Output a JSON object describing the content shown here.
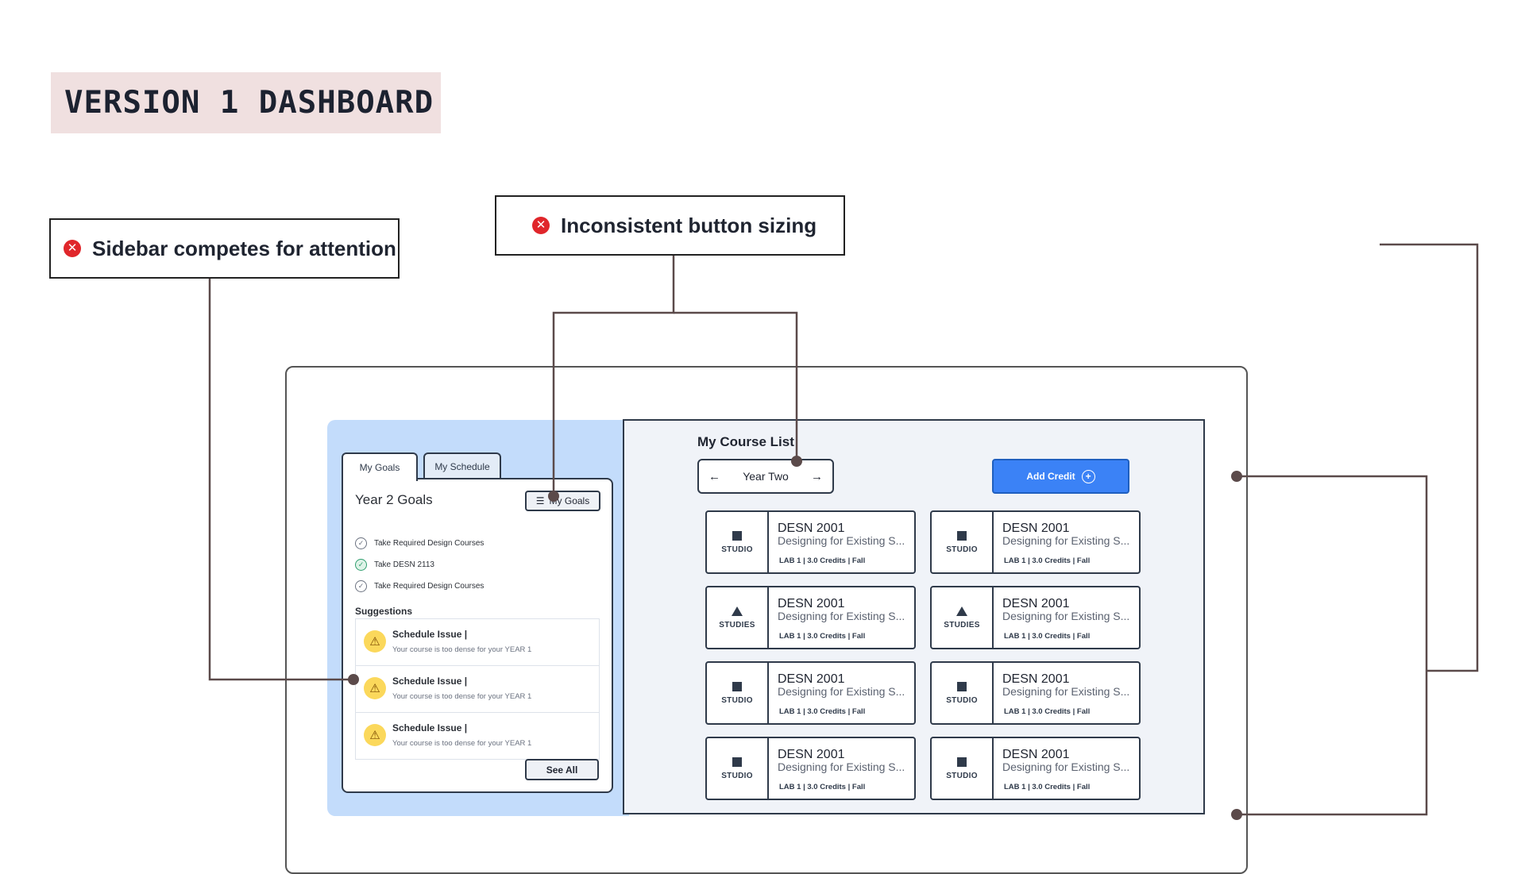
{
  "title": "VERSION 1 DASHBOARD",
  "callouts": {
    "sidebar": "Sidebar competes for attention",
    "buttons": "Inconsistent button sizing"
  },
  "sidebar": {
    "tabs": [
      "My Goals",
      "My Schedule"
    ],
    "card_title": "Year 2 Goals",
    "my_goals_button": "My Goals",
    "goals": [
      {
        "label": "Take Required Design Courses",
        "done": false
      },
      {
        "label": "Take DESN 2113",
        "done": true
      },
      {
        "label": "Take Required Design Courses",
        "done": false
      }
    ],
    "suggestions_label": "Suggestions",
    "suggestions": [
      {
        "title": "Schedule Issue |",
        "text": "Your course is too dense for your YEAR 1"
      },
      {
        "title": "Schedule Issue |",
        "text": "Your course is too dense for your YEAR 1"
      },
      {
        "title": "Schedule Issue |",
        "text": "Your course is too dense for your YEAR 1"
      }
    ],
    "see_all_button": "See All"
  },
  "main": {
    "title": "My Course List",
    "year_label": "Year Two",
    "add_credit_button": "Add Credit",
    "courses": [
      {
        "type": "STUDIO",
        "shape": "square",
        "code": "DESN 2001",
        "name": "Designing for Existing S...",
        "meta": "LAB 1 | 3.0 Credits | Fall"
      },
      {
        "type": "STUDIO",
        "shape": "square",
        "code": "DESN 2001",
        "name": "Designing for Existing S...",
        "meta": "LAB 1 | 3.0 Credits | Fall"
      },
      {
        "type": "STUDIES",
        "shape": "triangle",
        "code": "DESN 2001",
        "name": "Designing for Existing S...",
        "meta": "LAB 1 | 3.0 Credits | Fall"
      },
      {
        "type": "STUDIES",
        "shape": "triangle",
        "code": "DESN 2001",
        "name": "Designing for Existing S...",
        "meta": "LAB 1 | 3.0 Credits | Fall"
      },
      {
        "type": "STUDIO",
        "shape": "square",
        "code": "DESN 2001",
        "name": "Designing for Existing S...",
        "meta": "LAB 1 | 3.0 Credits | Fall"
      },
      {
        "type": "STUDIO",
        "shape": "square",
        "code": "DESN 2001",
        "name": "Designing for Existing S...",
        "meta": "LAB 1 | 3.0 Credits | Fall"
      },
      {
        "type": "STUDIO",
        "shape": "square",
        "code": "DESN 2001",
        "name": "Designing for Existing S...",
        "meta": "LAB 1 | 3.0 Credits | Fall"
      },
      {
        "type": "STUDIO",
        "shape": "square",
        "code": "DESN 2001",
        "name": "Designing for Existing S...",
        "meta": "LAB 1 | 3.0 Credits | Fall"
      }
    ]
  },
  "colors": {
    "accent": "#3b82f6",
    "error": "#e0262b",
    "sidebar_bg": "#c3dcfb",
    "warning": "#fbd85b",
    "title_bg": "#f0e0e0"
  }
}
